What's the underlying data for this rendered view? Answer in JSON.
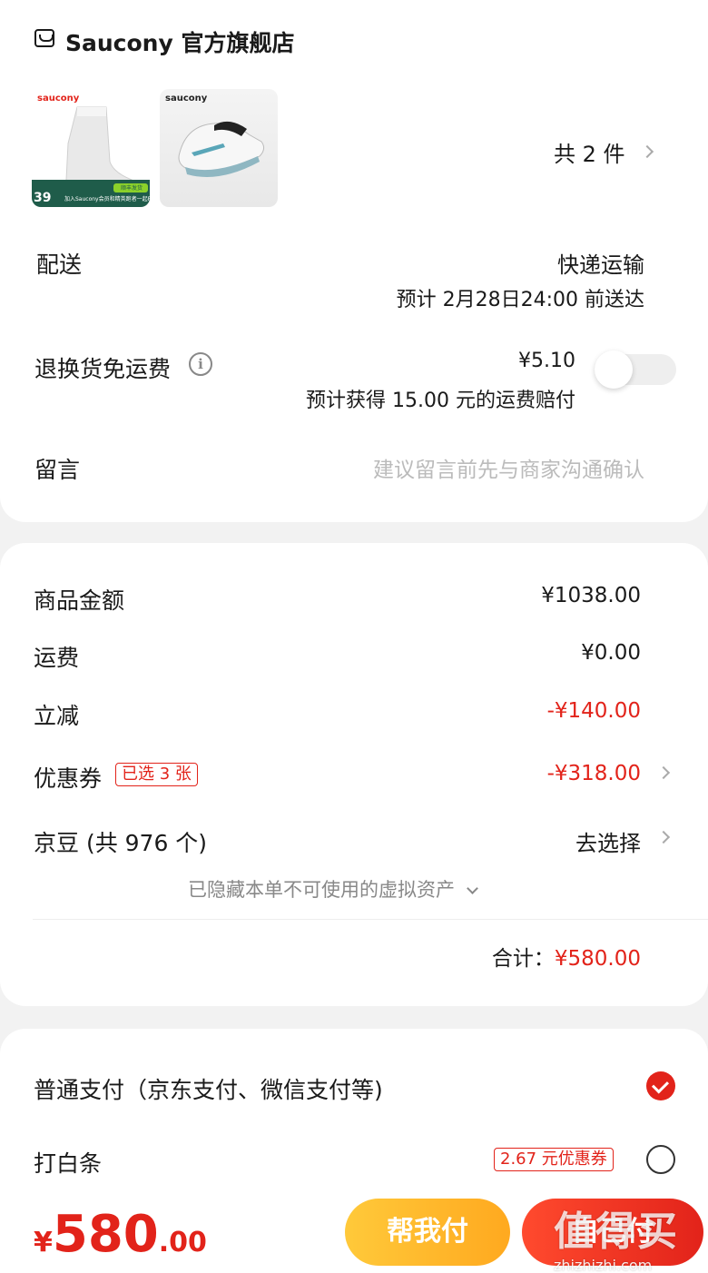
{
  "store": {
    "name": "Saucony 官方旗舰店"
  },
  "products": {
    "item1": {
      "brand": "saucony",
      "price_badge": "39",
      "banner": "加入Saucony会员和精英跑者一起PB",
      "ship_badge": "顺丰发货"
    },
    "item2": {
      "brand": "saucony"
    },
    "count_label": "共 2 件"
  },
  "delivery": {
    "label": "配送",
    "method": "快递运输",
    "eta": "预计 2月28日24:00 前送达"
  },
  "return_insurance": {
    "label": "退换货免运费",
    "price": "¥5.10",
    "desc": "预计获得 15.00 元的运费赔付",
    "enabled": false
  },
  "message": {
    "label": "留言",
    "placeholder": "建议留言前先与商家沟通确认"
  },
  "summary": {
    "goods_label": "商品金额",
    "goods_value": "¥1038.00",
    "shipping_label": "运费",
    "shipping_value": "¥0.00",
    "discount_label": "立减",
    "discount_value": "-¥140.00",
    "coupon_label": "优惠券",
    "coupon_tag": "已选 3 张",
    "coupon_value": "-¥318.00",
    "beans_label": "京豆 (共 976 个)",
    "beans_value": "去选择",
    "hidden_assets": "已隐藏本单不可使用的虚拟资产",
    "total_label": "合计：",
    "total_value": "¥580.00"
  },
  "payment": {
    "option1": "普通支付（京东支付、微信支付等)",
    "option2": "打白条",
    "option2_tag": "2.67 元优惠券"
  },
  "bottom": {
    "currency": "¥",
    "amount_int": "580",
    "amount_dec": ".00",
    "help_pay": "帮我付",
    "self_pay": "自己付",
    "watermark": "值得买",
    "watermark_url": "zhizhizhi.com"
  },
  "colors": {
    "accent": "#e2231a",
    "help_btn": "#ffb52a"
  }
}
